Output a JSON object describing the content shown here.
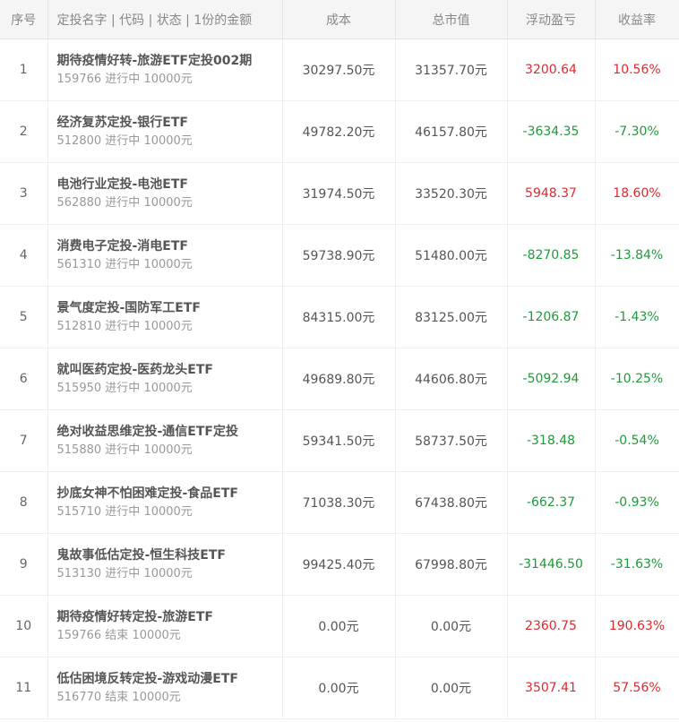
{
  "table": {
    "headers": {
      "index": "序号",
      "name": "定投名字 | 代码 | 状态 | 1份的金额",
      "cost": "成本",
      "market_value": "总市值",
      "pnl": "浮动盈亏",
      "rate": "收益率"
    },
    "rows": [
      {
        "index": "1",
        "name": "期待疫情好转-旅游ETF定投002期",
        "code": "159766",
        "status": "进行中",
        "unit_amount": "10000元",
        "cost": "30297.50元",
        "market_value": "31357.70元",
        "pnl": "3200.64",
        "rate": "10.56%",
        "trend": "pos"
      },
      {
        "index": "2",
        "name": "经济复苏定投-银行ETF",
        "code": "512800",
        "status": "进行中",
        "unit_amount": "10000元",
        "cost": "49782.20元",
        "market_value": "46157.80元",
        "pnl": "-3634.35",
        "rate": "-7.30%",
        "trend": "neg"
      },
      {
        "index": "3",
        "name": "电池行业定投-电池ETF",
        "code": "562880",
        "status": "进行中",
        "unit_amount": "10000元",
        "cost": "31974.50元",
        "market_value": "33520.30元",
        "pnl": "5948.37",
        "rate": "18.60%",
        "trend": "pos"
      },
      {
        "index": "4",
        "name": "消费电子定投-消电ETF",
        "code": "561310",
        "status": "进行中",
        "unit_amount": "10000元",
        "cost": "59738.90元",
        "market_value": "51480.00元",
        "pnl": "-8270.85",
        "rate": "-13.84%",
        "trend": "neg"
      },
      {
        "index": "5",
        "name": "景气度定投-国防军工ETF",
        "code": "512810",
        "status": "进行中",
        "unit_amount": "10000元",
        "cost": "84315.00元",
        "market_value": "83125.00元",
        "pnl": "-1206.87",
        "rate": "-1.43%",
        "trend": "neg"
      },
      {
        "index": "6",
        "name": "就叫医药定投-医药龙头ETF",
        "code": "515950",
        "status": "进行中",
        "unit_amount": "10000元",
        "cost": "49689.80元",
        "market_value": "44606.80元",
        "pnl": "-5092.94",
        "rate": "-10.25%",
        "trend": "neg"
      },
      {
        "index": "7",
        "name": "绝对收益思维定投-通信ETF定投",
        "code": "515880",
        "status": "进行中",
        "unit_amount": "10000元",
        "cost": "59341.50元",
        "market_value": "58737.50元",
        "pnl": "-318.48",
        "rate": "-0.54%",
        "trend": "neg"
      },
      {
        "index": "8",
        "name": "抄底女神不怕困难定投-食品ETF",
        "code": "515710",
        "status": "进行中",
        "unit_amount": "10000元",
        "cost": "71038.30元",
        "market_value": "67438.80元",
        "pnl": "-662.37",
        "rate": "-0.93%",
        "trend": "neg"
      },
      {
        "index": "9",
        "name": "鬼故事低估定投-恒生科技ETF",
        "code": "513130",
        "status": "进行中",
        "unit_amount": "10000元",
        "cost": "99425.40元",
        "market_value": "67998.80元",
        "pnl": "-31446.50",
        "rate": "-31.63%",
        "trend": "neg"
      },
      {
        "index": "10",
        "name": "期待疫情好转定投-旅游ETF",
        "code": "159766",
        "status": "结束",
        "unit_amount": "10000元",
        "cost": "0.00元",
        "market_value": "0.00元",
        "pnl": "2360.75",
        "rate": "190.63%",
        "trend": "pos"
      },
      {
        "index": "11",
        "name": "低估困境反转定投-游戏动漫ETF",
        "code": "516770",
        "status": "结束",
        "unit_amount": "10000元",
        "cost": "0.00元",
        "market_value": "0.00元",
        "pnl": "3507.41",
        "rate": "57.56%",
        "trend": "pos"
      }
    ]
  },
  "colors": {
    "positive": "#e0282e",
    "negative": "#1f9a3a",
    "header_bg": "#f5f5f5"
  }
}
